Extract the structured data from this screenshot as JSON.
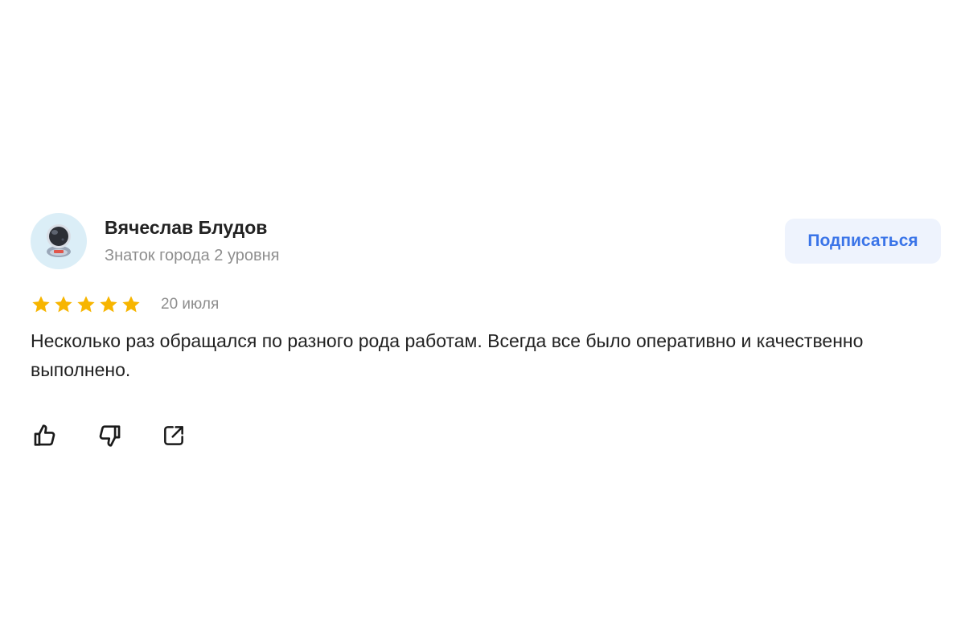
{
  "review": {
    "author_name": "Вячеслав Блудов",
    "author_level": "Знаток города 2 уровня",
    "subscribe_label": "Подписаться",
    "rating": 5,
    "rating_max": 5,
    "date": "20 июля",
    "text": "Несколько раз обращался по разного рода работам. Всегда все было оперативно и качественно выполнено."
  },
  "icons": {
    "avatar": "astronaut-avatar-icon",
    "star": "star-icon",
    "like": "thumbs-up-icon",
    "dislike": "thumbs-down-icon",
    "share": "share-icon"
  },
  "colors": {
    "star": "#f7b500",
    "subscribe_text": "#3a74e8",
    "subscribe_bg": "#eef3fd",
    "muted_text": "#8e8e8e",
    "avatar_bg": "#dbeef7"
  }
}
